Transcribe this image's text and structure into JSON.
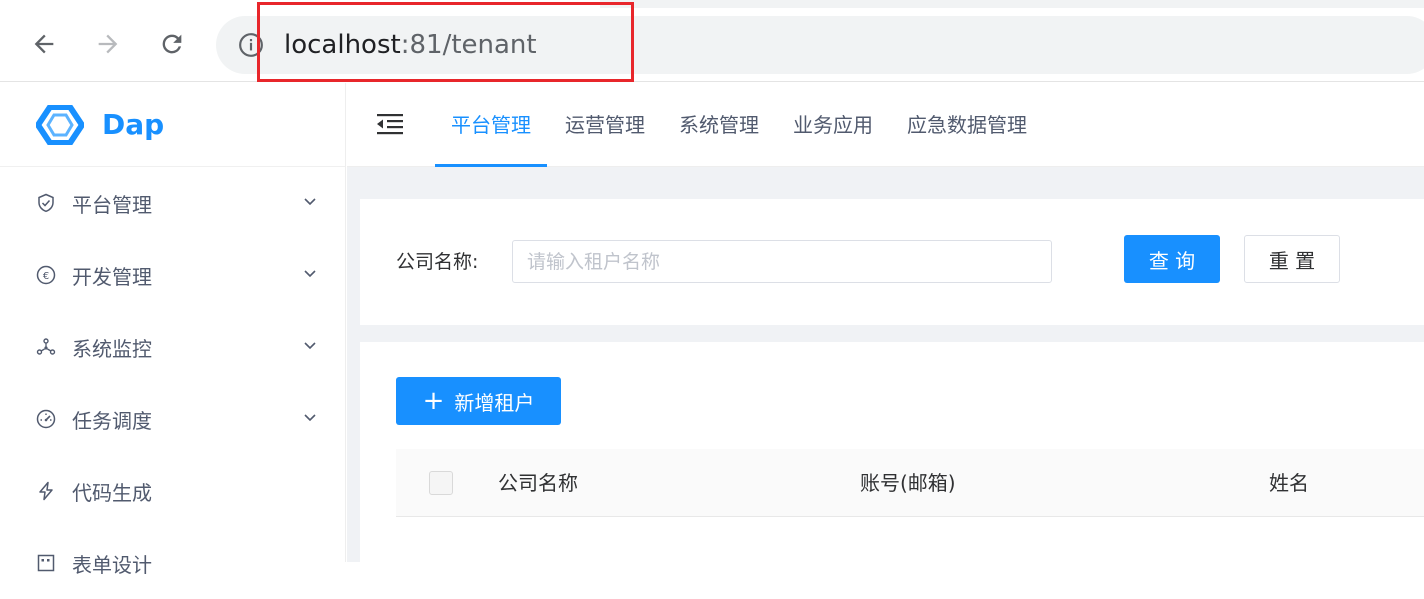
{
  "browser": {
    "url_host": "localhost",
    "url_rest": ":81/tenant"
  },
  "sidebar": {
    "logo_text": "Dap",
    "items": [
      {
        "label": "平台管理",
        "icon": "shield-check-icon",
        "has_arrow": true
      },
      {
        "label": "开发管理",
        "icon": "euro-circle-icon",
        "has_arrow": true
      },
      {
        "label": "系统监控",
        "icon": "cluster-icon",
        "has_arrow": true
      },
      {
        "label": "任务调度",
        "icon": "dashboard-gauge-icon",
        "has_arrow": true
      },
      {
        "label": "代码生成",
        "icon": "thunderbolt-icon",
        "has_arrow": false
      },
      {
        "label": "表单设计",
        "icon": "form-icon",
        "has_arrow": false
      }
    ]
  },
  "header": {
    "tabs": [
      {
        "label": "平台管理",
        "active": true
      },
      {
        "label": "运营管理",
        "active": false
      },
      {
        "label": "系统管理",
        "active": false
      },
      {
        "label": "业务应用",
        "active": false
      },
      {
        "label": "应急数据管理",
        "active": false
      }
    ]
  },
  "search": {
    "label": "公司名称:",
    "placeholder": "请输入租户名称",
    "value": "",
    "query_label": "查 询",
    "reset_label": "重 置"
  },
  "table": {
    "add_label": "新增租户",
    "columns": [
      "公司名称",
      "账号(邮箱)",
      "姓名"
    ]
  },
  "colors": {
    "primary": "#1890ff",
    "highlight_box": "#e8262b"
  }
}
